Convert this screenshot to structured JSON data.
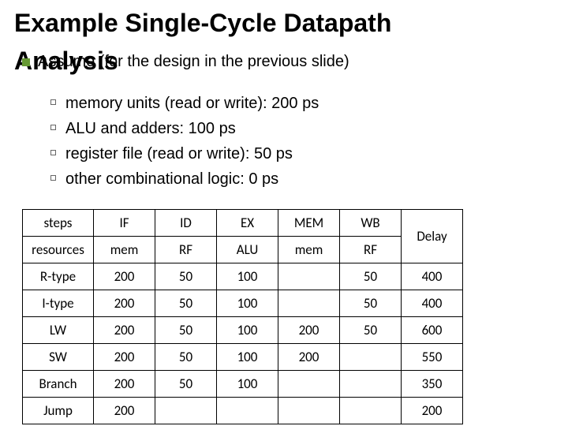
{
  "title_line1": "Example Single-Cycle Datapath",
  "title_line2": "Analysis",
  "intro": "Assume (for the design in the previous slide)",
  "bullets": [
    "memory units (read or write): 200 ps",
    "ALU and adders: 100 ps",
    "register file (read or write): 50 ps",
    "other combinational logic: 0 ps"
  ],
  "chart_data": {
    "type": "table",
    "header_row1": {
      "label": "steps",
      "cols": [
        "IF",
        "ID",
        "EX",
        "MEM",
        "WB"
      ],
      "last": ""
    },
    "header_row2": {
      "label": "resources",
      "cols": [
        "mem",
        "RF",
        "ALU",
        "mem",
        "RF"
      ],
      "last": "Delay"
    },
    "rows": [
      {
        "label": "R-type",
        "cells": [
          "200",
          "50",
          "100",
          "",
          "50"
        ],
        "delay": "400"
      },
      {
        "label": "I-type",
        "cells": [
          "200",
          "50",
          "100",
          "",
          "50"
        ],
        "delay": "400"
      },
      {
        "label": "LW",
        "cells": [
          "200",
          "50",
          "100",
          "200",
          "50"
        ],
        "delay": "600"
      },
      {
        "label": "SW",
        "cells": [
          "200",
          "50",
          "100",
          "200",
          ""
        ],
        "delay": "550"
      },
      {
        "label": "Branch",
        "cells": [
          "200",
          "50",
          "100",
          "",
          ""
        ],
        "delay": "350"
      },
      {
        "label": "Jump",
        "cells": [
          "200",
          "",
          "",
          "",
          ""
        ],
        "delay": "200"
      }
    ]
  }
}
